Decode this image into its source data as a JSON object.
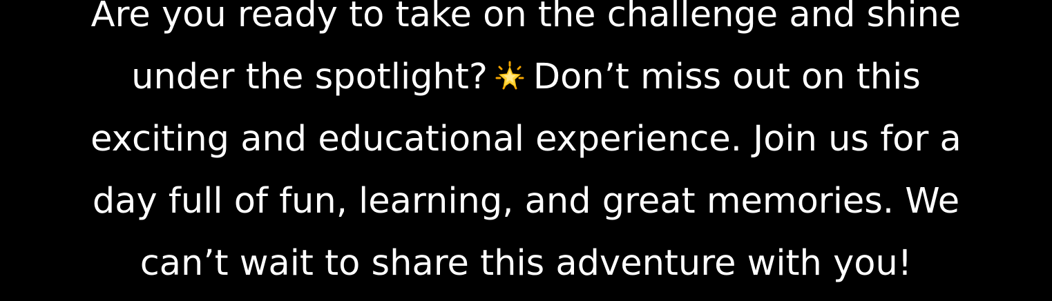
{
  "message": {
    "line1": "Are you ready to take on the challenge and shine",
    "line2_before": "under the spotlight?",
    "line2_icon": "glowing-star-icon",
    "line2_after": "Don’t miss out on this",
    "line3": "exciting and educational experience. Join us for a",
    "line4": "day full of fun, learning, and great memories. We",
    "line5": "can’t wait to share this adventure with you!"
  },
  "colors": {
    "background": "#000000",
    "text": "#ffffff",
    "star_fill": "#FFD43B",
    "star_accent": "#F7A600"
  }
}
